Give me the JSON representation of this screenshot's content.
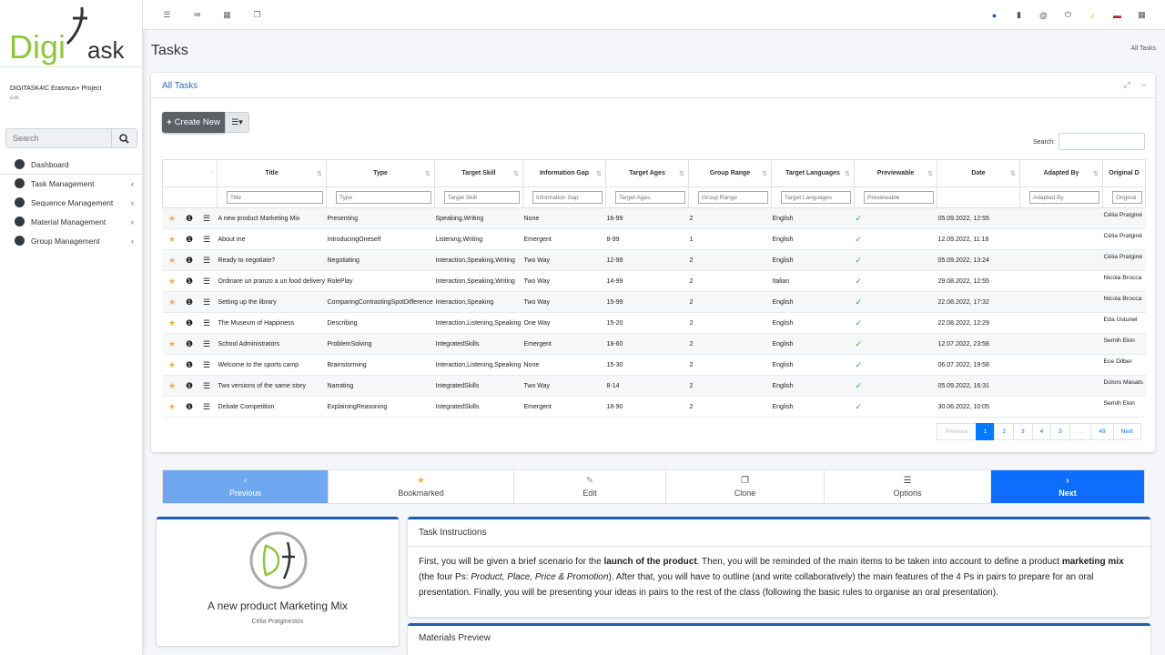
{
  "brand": {
    "logo_text_left": "Digi",
    "logo_text_right": "ask"
  },
  "project": {
    "title": "DIGITASK4IC Erasmus+ Project",
    "edit": "Edit"
  },
  "sidebar": {
    "search_placeholder": "Search",
    "items": [
      {
        "label": "Dashboard",
        "has_chevron": false
      },
      {
        "label": "Task Management",
        "has_chevron": true
      },
      {
        "label": "Sequence Management",
        "has_chevron": true
      },
      {
        "label": "Material Management",
        "has_chevron": true
      },
      {
        "label": "Group Management",
        "has_chevron": true
      }
    ]
  },
  "topbar": {
    "left_icons": [
      "menu-icon",
      "list-icon",
      "calendar-icon",
      "windows-icon"
    ],
    "right_icons": [
      "help-icon",
      "trash-icon",
      "at-icon",
      "power-icon",
      "bell-icon",
      "us-flag-icon",
      "grid-icon"
    ]
  },
  "page": {
    "title": "Tasks",
    "breadcrumb": "All Tasks"
  },
  "card": {
    "title": "All Tasks",
    "create_label": "Create New",
    "search_label": "Search:",
    "columns": [
      "Title",
      "Type",
      "Target Skill",
      "Information Gap",
      "Target Ages",
      "Group Range",
      "Target Languages",
      "Previewable",
      "Date",
      "Adapted By",
      "Original D"
    ],
    "filters": [
      "Title",
      "Type",
      "Target Skill",
      "Information Gap",
      "Target Ages",
      "Group Range",
      "Target Languages",
      "Previewable",
      "",
      "Adapted By",
      "Original D"
    ],
    "rows": [
      {
        "title": "A new product Marketing Mix",
        "type": "Presenting",
        "skill": "Speaking,Writing",
        "gap": "None",
        "ages": "16-99",
        "range": "2",
        "lang": "English",
        "date": "05.09.2022, 12:55",
        "adapted": "",
        "orig": "Célia Pratginé"
      },
      {
        "title": "About me",
        "type": "IntroducingOneself",
        "skill": "Listening,Writing",
        "gap": "Emergent",
        "ages": "8-99",
        "range": "1",
        "lang": "English",
        "date": "12.09.2022, 11:16",
        "adapted": "",
        "orig": "Célia Pratginé"
      },
      {
        "title": "Ready to negotiate?",
        "type": "Negotiating",
        "skill": "Interaction,Speaking,Writing",
        "gap": "Two Way",
        "ages": "12-99",
        "range": "2",
        "lang": "English",
        "date": "05.09.2022, 13:24",
        "adapted": "",
        "orig": "Célia Pratginé"
      },
      {
        "title": "Ordinare un pranzo a un food delivery",
        "type": "RolePlay",
        "skill": "Interaction,Speaking,Writing",
        "gap": "Two Way",
        "ages": "14-99",
        "range": "2",
        "lang": "Italian",
        "date": "29.08.2022, 12:55",
        "adapted": "",
        "orig": "Nicola Brocca"
      },
      {
        "title": "Setting up the library",
        "type": "ComparingContrastingSpotDifference",
        "skill": "Interaction,Speaking",
        "gap": "Two Way",
        "ages": "15-99",
        "range": "2",
        "lang": "English",
        "date": "22.08.2022, 17:32",
        "adapted": "",
        "orig": "Nicola Brocca"
      },
      {
        "title": "The Museum of Happiness",
        "type": "Describing",
        "skill": "Interaction,Listening,Speaking",
        "gap": "One Way",
        "ages": "15-20",
        "range": "2",
        "lang": "English",
        "date": "22.08.2022, 12:29",
        "adapted": "",
        "orig": "Eda Ustunel"
      },
      {
        "title": "School Administrators",
        "type": "ProblemSolving",
        "skill": "IntegratedSkills",
        "gap": "Emergent",
        "ages": "18-60",
        "range": "2",
        "lang": "English",
        "date": "12.07.2022, 23:58",
        "adapted": "",
        "orig": "Semih Ekin"
      },
      {
        "title": "Welcome to the sports camp",
        "type": "Brainstorming",
        "skill": "Interaction,Listening,Speaking",
        "gap": "None",
        "ages": "15-30",
        "range": "2",
        "lang": "English",
        "date": "06.07.2022, 19:58",
        "adapted": "",
        "orig": "Ece Dilber"
      },
      {
        "title": "Two versions of the same story",
        "type": "Narrating",
        "skill": "IntegratedSkills",
        "gap": "Two Way",
        "ages": "8-14",
        "range": "2",
        "lang": "English",
        "date": "05.09.2022, 16:31",
        "adapted": "",
        "orig": "Dolors Masats"
      },
      {
        "title": "Debate Competition",
        "type": "ExplainingReasoning",
        "skill": "IntegratedSkills",
        "gap": "Emergent",
        "ages": "18-90",
        "range": "2",
        "lang": "English",
        "date": "30.06.2022, 10:05",
        "adapted": "",
        "orig": "Semih Ekin"
      }
    ],
    "pagination": [
      "Previous",
      "1",
      "2",
      "3",
      "4",
      "5",
      "…",
      "49",
      "Next"
    ]
  },
  "actions": [
    {
      "label": "Previous",
      "icon": "chevron-left-icon",
      "glyph": "‹"
    },
    {
      "label": "Bookmarked",
      "icon": "star-icon",
      "glyph": "★"
    },
    {
      "label": "Edit",
      "icon": "pencil-icon",
      "glyph": "✎"
    },
    {
      "label": "Clone",
      "icon": "copy-icon",
      "glyph": "❐"
    },
    {
      "label": "Options",
      "icon": "bars-icon",
      "glyph": "☰"
    },
    {
      "label": "Next",
      "icon": "chevron-right-icon",
      "glyph": "›"
    }
  ],
  "task": {
    "title": "A new product Marketing Mix",
    "author": "Célia Pratginestós",
    "instructions_title": "Task Instructions",
    "instructions": [
      {
        "t": "First, you will be given a brief scenario for the ",
        "s": "n"
      },
      {
        "t": "launch of the product",
        "s": "b"
      },
      {
        "t": ". Then, you will be reminded of the main items to be taken into account to define a product ",
        "s": "n"
      },
      {
        "t": "marketing mix",
        "s": "b"
      },
      {
        "t": " (the four Ps: ",
        "s": "n"
      },
      {
        "t": "Product, Place, Price & Promotion",
        "s": "i"
      },
      {
        "t": "). After that, you will have to outline (and write collaboratively) the main features of the 4 Ps in pairs to prepare for an oral presentation. Finally, you will be presenting your ideas in pairs to the rest of the class (following the basic rules to organise an oral presentation).",
        "s": "n"
      }
    ],
    "materials_title": "Materials Preview"
  },
  "colors": {
    "accent": "#007bff",
    "next": "#0d6efd",
    "prev": "#6fa8f0",
    "star": "#f0ad4e",
    "check": "#28a745",
    "logo_green": "#8dc63f"
  }
}
